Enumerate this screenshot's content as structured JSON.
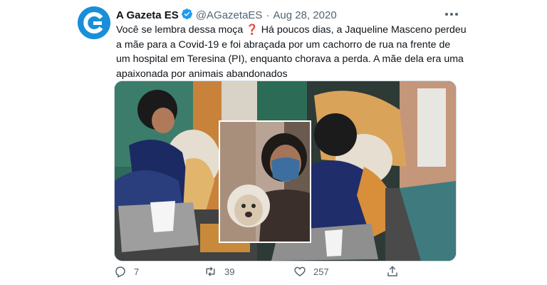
{
  "tweet": {
    "author_name": "A Gazeta ES",
    "handle": "@AGazetaES",
    "separator": "·",
    "date": "Aug 28, 2020",
    "text_lines": [
      "Você se lembra dessa moça",
      " Há poucos dias, a Jaqueline Masceno perdeu",
      "a mãe para a Covid-19 e foi abraçada por um cachorro de rua na frente de",
      "um hospital em Teresina (PI), enquanto chorava a perda. A mãe dela era uma",
      "apaixonada por animais abandonados"
    ],
    "emoji": "❓",
    "brand_color": "#1a8fd8",
    "verified_color": "#1d9bf0"
  },
  "actions": {
    "reply_count": "7",
    "retweet_count": "39",
    "like_count": "257"
  },
  "icons": [
    "gazeta-logo-icon",
    "verified-badge-icon",
    "more-options-icon",
    "reply-icon",
    "retweet-icon",
    "like-icon",
    "share-icon"
  ]
}
